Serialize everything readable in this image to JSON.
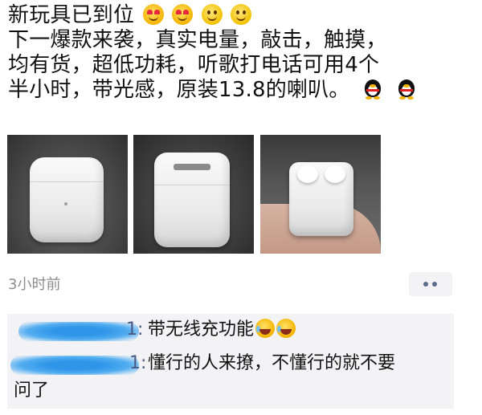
{
  "post": {
    "lines": [
      "新玩具已到位",
      "下一爆款来袭，真实电量，敲击，触摸，",
      "均有货，超低功耗，听歌打电话可用4个",
      "半小时，带光感，原装13.8的喇叭。"
    ],
    "emoji_line1": [
      "heart-eyes-emoji",
      "heart-eyes-emoji",
      "smile-emoji",
      "smile-emoji"
    ],
    "emoji_line4": [
      "qq-penguin-emoji",
      "qq-penguin-emoji"
    ]
  },
  "photos": [
    {
      "name": "airpods-case-front-photo"
    },
    {
      "name": "airpods-case-back-photo"
    },
    {
      "name": "airpods-case-open-photo"
    }
  ],
  "meta": {
    "timestamp": "3小时前",
    "more_icon": "more-dots-icon"
  },
  "comments": [
    {
      "author_tail": "1",
      "separator": ":",
      "text": "带无线充功能",
      "emoji": [
        "laugh-cry-emoji",
        "laugh-cry-emoji"
      ]
    },
    {
      "author_tail": "1",
      "separator": ":",
      "text": "懂行的人来撩，不懂行的就不要",
      "text_cont": "问了"
    }
  ],
  "colors": {
    "name_link": "#4a5a84",
    "comment_bg": "#f3f3f5",
    "meta_text": "#8d8d8d",
    "redaction": "#2f95e8"
  }
}
